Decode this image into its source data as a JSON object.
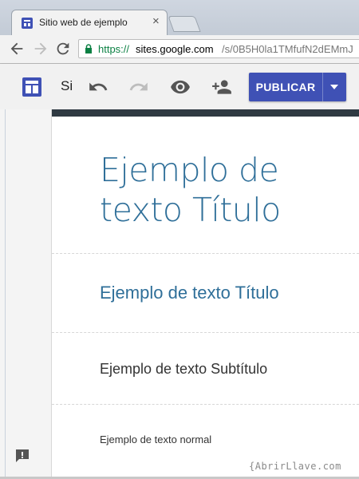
{
  "browser": {
    "tab_title": "Sitio web de ejemplo",
    "tab_close": "×",
    "url_scheme": "https://",
    "url_host": "sites.google.com",
    "url_path": "/s/0B5H0la1TMfufN2dEMmJ"
  },
  "toolbar": {
    "site_name": "Si",
    "publish_label": "PUBLICAR",
    "accent_color": "#3f51b5"
  },
  "page": {
    "main_title": "Ejemplo de texto Título",
    "heading": "Ejemplo de texto Título",
    "subtitle": "Ejemplo de texto Subtítulo",
    "normal_text": "Ejemplo de texto normal",
    "title_color": "#2f6f99"
  },
  "watermark": "{AbrirLlave.com"
}
